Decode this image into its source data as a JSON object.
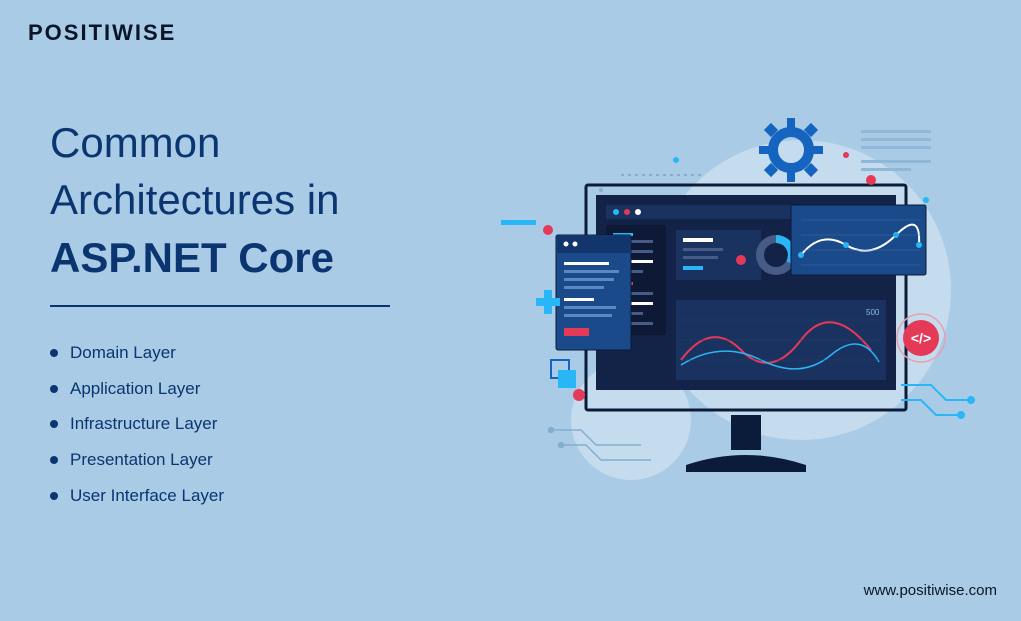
{
  "logo": "POSITIWISE",
  "title": {
    "line1": "Common",
    "line2": "Architectures in",
    "line3": "ASP.NET Core"
  },
  "bullets": [
    "Domain Layer",
    "Application Layer",
    "Infrastructure Layer",
    "Presentation Layer",
    "User Interface Layer"
  ],
  "url": "www.positiwise.com"
}
